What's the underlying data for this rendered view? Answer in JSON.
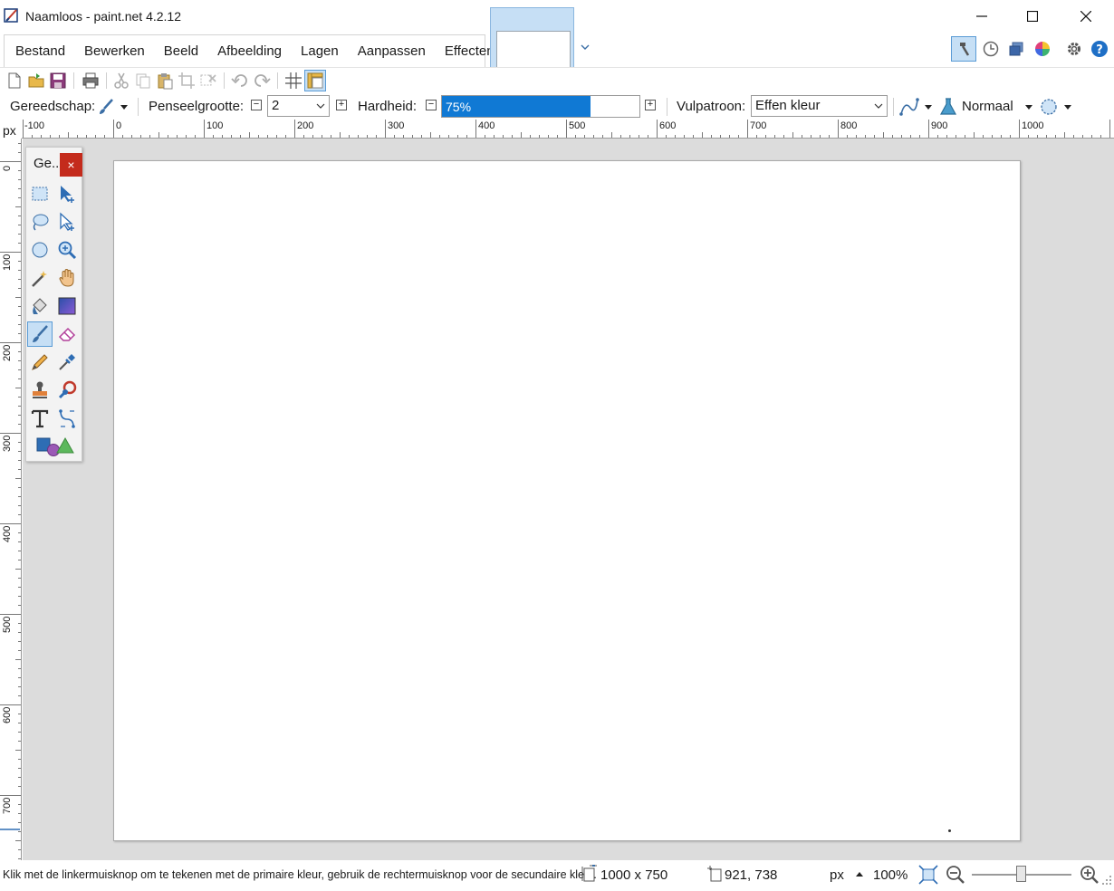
{
  "window": {
    "title": "Naamloos - paint.net 4.2.12",
    "minimize_icon": "minimize-icon",
    "maximize_icon": "maximize-icon",
    "close_icon": "close-icon"
  },
  "menu": {
    "items": [
      "Bestand",
      "Bewerken",
      "Beeld",
      "Afbeelding",
      "Lagen",
      "Aanpassen",
      "Effecten"
    ]
  },
  "options": {
    "tool_label": "Gereedschap:",
    "brush_size_label": "Penseelgrootte:",
    "brush_size_value": "2",
    "hardness_label": "Hardheid:",
    "hardness_value": "75%",
    "hardness_fraction": 0.75,
    "fill_label": "Vulpatroon:",
    "fill_value": "Effen kleur",
    "blend_mode": "Normaal"
  },
  "rulers": {
    "unit": "px",
    "top_labels": [
      "-100",
      "0",
      "100",
      "200",
      "300",
      "400",
      "500",
      "600",
      "700",
      "800",
      "900",
      "1000"
    ],
    "left_labels": [
      "0",
      "100",
      "200",
      "300",
      "400",
      "500",
      "600",
      "700"
    ]
  },
  "tools_window": {
    "title": "Ge...",
    "close_label": "×"
  },
  "status": {
    "hint": "Klik met de linkermuisknop om te tekenen met de primaire kleur, gebruik de rechtermuisknop voor de secundaire kleur.",
    "image_size": "1000 x 750",
    "cursor_position": "921, 738",
    "unit": "px",
    "zoom": "100%"
  },
  "colors": {
    "accent": "#1079d4",
    "selected_bg": "#c6dff5",
    "close_red": "#c42b1c",
    "workspace": "#dcdcdc"
  }
}
